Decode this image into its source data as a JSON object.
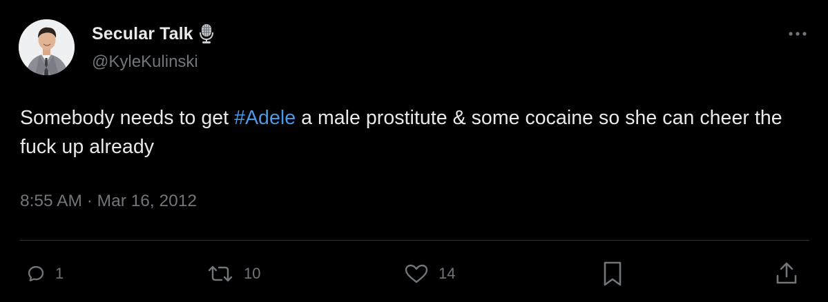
{
  "author": {
    "display_name": "Secular Talk",
    "handle": "@KyleKulinski",
    "verified_icon": "podcast-microphone-icon"
  },
  "tweet": {
    "text_before": "Somebody needs to get ",
    "hashtag": "#Adele",
    "text_after": " a male prostitute & some cocaine so she can cheer the fuck up already",
    "time": "8:55 AM",
    "separator": " · ",
    "date": "Mar 16, 2012"
  },
  "actions": {
    "replies": "1",
    "retweets": "10",
    "likes": "14"
  },
  "colors": {
    "background": "#000000",
    "text": "#e7e9ea",
    "secondary": "#71767b",
    "link": "#4a99e9",
    "divider": "#2f3336"
  },
  "icons": {
    "more": "more-horizontal-icon",
    "reply": "reply-bubble-icon",
    "retweet": "retweet-icon",
    "like": "heart-icon",
    "bookmark": "bookmark-icon",
    "share": "share-upload-icon"
  }
}
